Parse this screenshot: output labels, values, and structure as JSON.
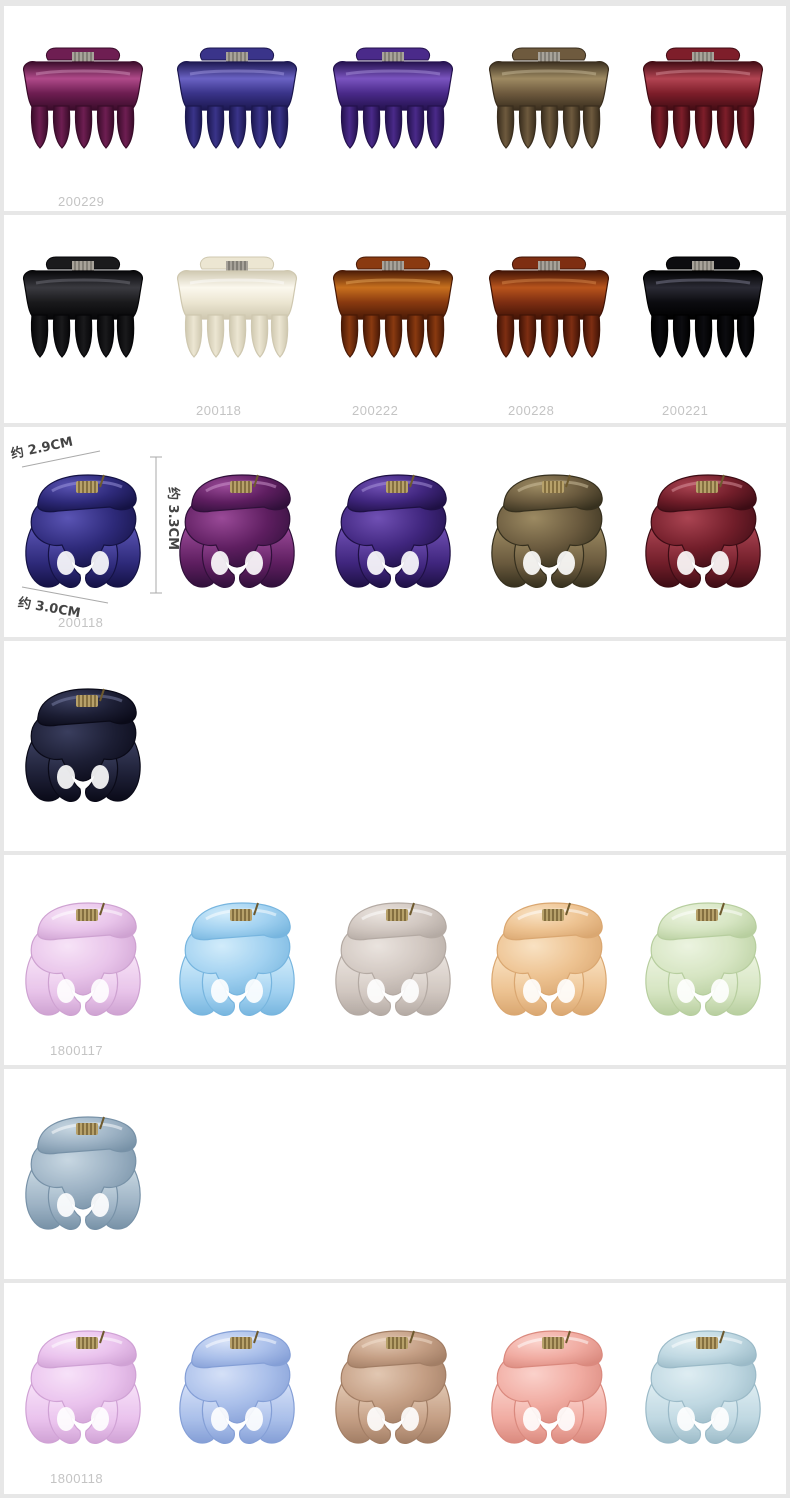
{
  "rows": [
    {
      "style": "claw",
      "code": "200229",
      "codeCol": 0,
      "colors": [
        {
          "name": "magenta",
          "base": "#6e1e52",
          "light": "#b04a8a",
          "dark": "#3a0c2a",
          "sheen": "#d89ac0",
          "clear": false
        },
        {
          "name": "indigo",
          "base": "#3a348a",
          "light": "#6a62c4",
          "dark": "#1c1850",
          "sheen": "#a8a0e6",
          "clear": false
        },
        {
          "name": "violet",
          "base": "#4a2a8a",
          "light": "#7a54c0",
          "dark": "#24124e",
          "sheen": "#b09ae0",
          "clear": false
        },
        {
          "name": "bronze",
          "base": "#6e5a3e",
          "light": "#9e8a62",
          "dark": "#3a2e1e",
          "sheen": "#cfc0a0",
          "clear": false
        },
        {
          "name": "burgundy",
          "base": "#7e1e2a",
          "light": "#b24452",
          "dark": "#420c14",
          "sheen": "#de98a2",
          "clear": false
        }
      ]
    },
    {
      "style": "claw",
      "code": "",
      "codeCol": 0,
      "colors": [
        {
          "name": "black",
          "base": "#1a1a1c",
          "light": "#3a3a40",
          "dark": "#060608",
          "sheen": "#7a7a82",
          "clear": false
        },
        {
          "name": "ivory",
          "base": "#ece6d2",
          "light": "#fbf8ee",
          "dark": "#cfc8b0",
          "sheen": "#ffffff",
          "clear": false
        },
        {
          "name": "tortoise-amber",
          "base": "#8a3a10",
          "light": "#c8701e",
          "dark": "#4a1a06",
          "sheen": "#f0b060",
          "clear": false
        },
        {
          "name": "tortoise-brown",
          "base": "#7e2e12",
          "light": "#b8541c",
          "dark": "#421406",
          "sheen": "#e09050",
          "clear": false
        },
        {
          "name": "glossy-black",
          "base": "#0c0c10",
          "light": "#2a2a34",
          "dark": "#000000",
          "sheen": "#8a8aa0",
          "clear": false
        }
      ],
      "codes": [
        "",
        "200118",
        "200222",
        "200228",
        "200221"
      ]
    },
    {
      "style": "octopus",
      "code": "200118",
      "codeCol": 0,
      "colors": [
        {
          "name": "navy-blue",
          "base": "#2e2a7a",
          "light": "#5a54b4",
          "dark": "#141244",
          "sheen": "#a09ae0",
          "clear": false
        },
        {
          "name": "plum",
          "base": "#5e1e60",
          "light": "#9a4a98",
          "dark": "#30103a",
          "sheen": "#d09ad0",
          "clear": false
        },
        {
          "name": "violet",
          "base": "#40267e",
          "light": "#7050b4",
          "dark": "#1e1044",
          "sheen": "#ac98dc",
          "clear": false
        },
        {
          "name": "bronze",
          "base": "#6a5a3e",
          "light": "#9c8a62",
          "dark": "#36301e",
          "sheen": "#d0c2a0",
          "clear": false
        },
        {
          "name": "burgundy",
          "base": "#721e2a",
          "light": "#aa4452",
          "dark": "#3c0c14",
          "sheen": "#dc98a2",
          "clear": false
        }
      ]
    },
    {
      "style": "octopus",
      "code": "",
      "codeCol": 0,
      "colors": [
        {
          "name": "midnight",
          "base": "#1c1e34",
          "light": "#3a3e5e",
          "dark": "#0a0a18",
          "sheen": "#7c82a8",
          "clear": false
        }
      ]
    },
    {
      "style": "octopus",
      "code": "1800117",
      "codeCol": 0,
      "colors": [
        {
          "name": "pink",
          "base": "#e4b8e6",
          "light": "#f6def6",
          "dark": "#c48ec8",
          "sheen": "#ffffff",
          "clear": true
        },
        {
          "name": "sky-blue",
          "base": "#8ec8ee",
          "light": "#c8e8fa",
          "dark": "#5aa6d8",
          "sheen": "#ffffff",
          "clear": true
        },
        {
          "name": "taupe",
          "base": "#c8bcb4",
          "light": "#e6ded8",
          "dark": "#a49890",
          "sheen": "#ffffff",
          "clear": true
        },
        {
          "name": "amber",
          "base": "#eab67a",
          "light": "#f8dcb6",
          "dark": "#d29452",
          "sheen": "#ffffff",
          "clear": true
        },
        {
          "name": "mint",
          "base": "#cee0b6",
          "light": "#e8f2da",
          "dark": "#a8c48a",
          "sheen": "#ffffff",
          "clear": true
        }
      ]
    },
    {
      "style": "octopus",
      "code": "",
      "codeCol": 0,
      "colors": [
        {
          "name": "slate-blue",
          "base": "#88a2b8",
          "light": "#bccfdc",
          "dark": "#5a7a94",
          "sheen": "#ffffff",
          "clear": true
        }
      ]
    },
    {
      "style": "octopus",
      "code": "1800118",
      "codeCol": 0,
      "colors": [
        {
          "name": "lavender-pink",
          "base": "#e6b6ea",
          "light": "#f6dcf8",
          "dark": "#c68ecc",
          "sheen": "#ffffff",
          "clear": true
        },
        {
          "name": "periwinkle",
          "base": "#98b2e6",
          "light": "#ccdaf6",
          "dark": "#6a8ace",
          "sheen": "#ffffff",
          "clear": true
        },
        {
          "name": "mocha",
          "base": "#b88a6a",
          "light": "#dcbca2",
          "dark": "#8e6244",
          "sheen": "#f2dcc8",
          "clear": true
        },
        {
          "name": "coral",
          "base": "#ee9a8e",
          "light": "#fac8c0",
          "dark": "#d27062",
          "sheen": "#ffffff",
          "clear": true
        },
        {
          "name": "ice-blue",
          "base": "#b2d0dc",
          "light": "#d8eaf0",
          "dark": "#86acbc",
          "sheen": "#ffffff",
          "clear": true
        }
      ]
    }
  ],
  "dimensions": {
    "width_top": "约 2.9CM",
    "height": "约 3.3CM",
    "width_bottom": "约 3.0CM"
  }
}
